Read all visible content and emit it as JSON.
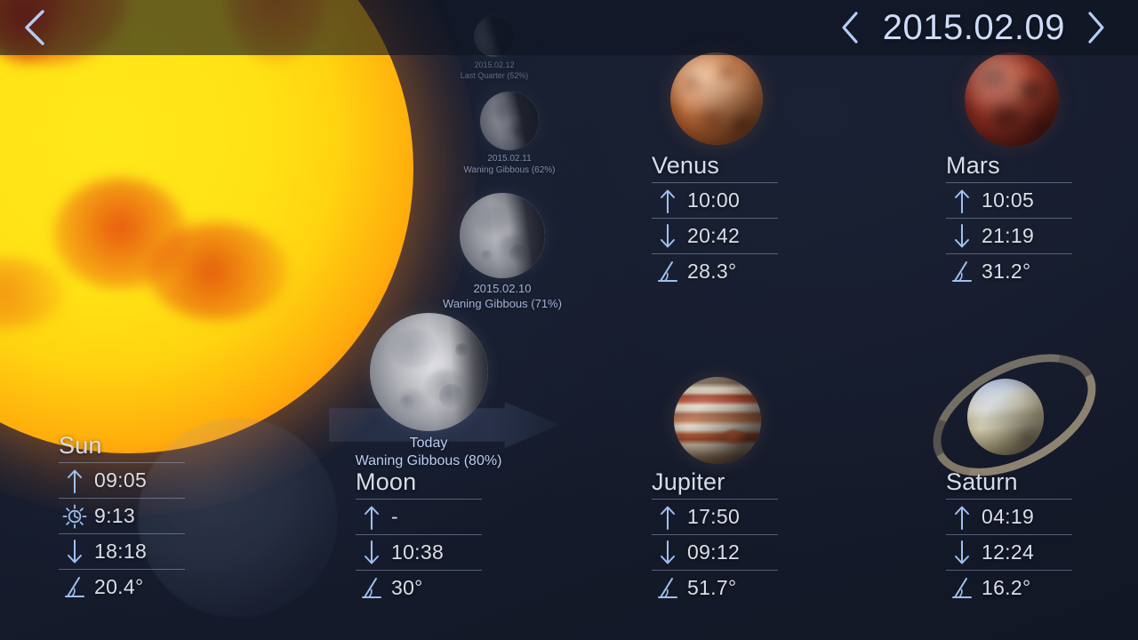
{
  "app": {
    "background_color": "#141a2b",
    "accent_color": "#a8c2f0"
  },
  "header": {
    "date": "2015.02.09",
    "back_label": "Back",
    "prev_day_label": "Previous day",
    "next_day_label": "Next day",
    "icons": {
      "back": "chevron-left-icon",
      "prev": "chevron-left-icon",
      "next": "chevron-right-icon"
    }
  },
  "moon_timeline": [
    {
      "date": "2015.02.12",
      "phase": "Last Quarter (52%)",
      "illumination": 52
    },
    {
      "date": "2015.02.11",
      "phase": "Waning Gibbous (62%)",
      "illumination": 62
    },
    {
      "date": "2015.02.10",
      "phase": "Waning Gibbous (71%)",
      "illumination": 71
    },
    {
      "date": "Today",
      "phase": "Waning Gibbous (80%)",
      "illumination": 80
    }
  ],
  "row_icons": {
    "rise": "arrow-up-icon",
    "set": "arrow-down-icon",
    "altitude": "angle-icon",
    "transit": "sun-clock-icon"
  },
  "bodies": [
    {
      "name": "Sun",
      "graphic": "sun-disc",
      "rows": [
        {
          "icon": "arrow-up-icon",
          "label": "Rise",
          "value": "09:05"
        },
        {
          "icon": "sun-clock-icon",
          "label": "Transit",
          "value": "9:13"
        },
        {
          "icon": "arrow-down-icon",
          "label": "Set",
          "value": "18:18"
        },
        {
          "icon": "angle-icon",
          "label": "Altitude",
          "value": "20.4°"
        }
      ]
    },
    {
      "name": "Moon",
      "graphic": "moon-disc",
      "rows": [
        {
          "icon": "arrow-up-icon",
          "label": "Rise",
          "value": "-"
        },
        {
          "icon": "arrow-down-icon",
          "label": "Set",
          "value": "10:38"
        },
        {
          "icon": "angle-icon",
          "label": "Altitude",
          "value": "30°"
        }
      ]
    },
    {
      "name": "Venus",
      "graphic": "venus-disc",
      "rows": [
        {
          "icon": "arrow-up-icon",
          "label": "Rise",
          "value": "10:00"
        },
        {
          "icon": "arrow-down-icon",
          "label": "Set",
          "value": "20:42"
        },
        {
          "icon": "angle-icon",
          "label": "Altitude",
          "value": "28.3°"
        }
      ]
    },
    {
      "name": "Mars",
      "graphic": "mars-disc",
      "rows": [
        {
          "icon": "arrow-up-icon",
          "label": "Rise",
          "value": "10:05"
        },
        {
          "icon": "arrow-down-icon",
          "label": "Set",
          "value": "21:19"
        },
        {
          "icon": "angle-icon",
          "label": "Altitude",
          "value": "31.2°"
        }
      ]
    },
    {
      "name": "Jupiter",
      "graphic": "jupiter-disc",
      "rows": [
        {
          "icon": "arrow-up-icon",
          "label": "Rise",
          "value": "17:50"
        },
        {
          "icon": "arrow-down-icon",
          "label": "Set",
          "value": "09:12"
        },
        {
          "icon": "angle-icon",
          "label": "Altitude",
          "value": "51.7°"
        }
      ]
    },
    {
      "name": "Saturn",
      "graphic": "saturn-disc",
      "rows": [
        {
          "icon": "arrow-up-icon",
          "label": "Rise",
          "value": "04:19"
        },
        {
          "icon": "arrow-down-icon",
          "label": "Set",
          "value": "12:24"
        },
        {
          "icon": "angle-icon",
          "label": "Altitude",
          "value": "16.2°"
        }
      ]
    }
  ]
}
